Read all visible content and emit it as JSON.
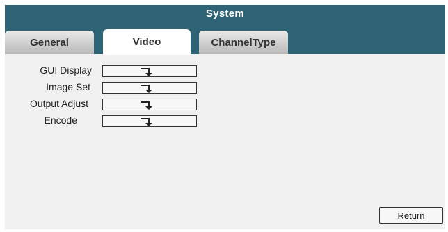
{
  "window": {
    "title": "System"
  },
  "tabs": [
    {
      "label": "General",
      "active": false
    },
    {
      "label": "Video",
      "active": true
    },
    {
      "label": "ChannelType",
      "active": false
    }
  ],
  "settings": [
    {
      "label": "GUI Display",
      "icon": "enter-arrow-icon"
    },
    {
      "label": "Image Set",
      "icon": "enter-arrow-icon"
    },
    {
      "label": "Output Adjust",
      "icon": "enter-arrow-icon"
    },
    {
      "label": "Encode",
      "icon": "enter-arrow-icon"
    }
  ],
  "footer": {
    "return_label": "Return"
  },
  "colors": {
    "title_bar": "#2e6375",
    "panel_background": "#f0f0f0",
    "active_tab": "#ffffff",
    "inactive_tab": "#c8c8c8"
  }
}
